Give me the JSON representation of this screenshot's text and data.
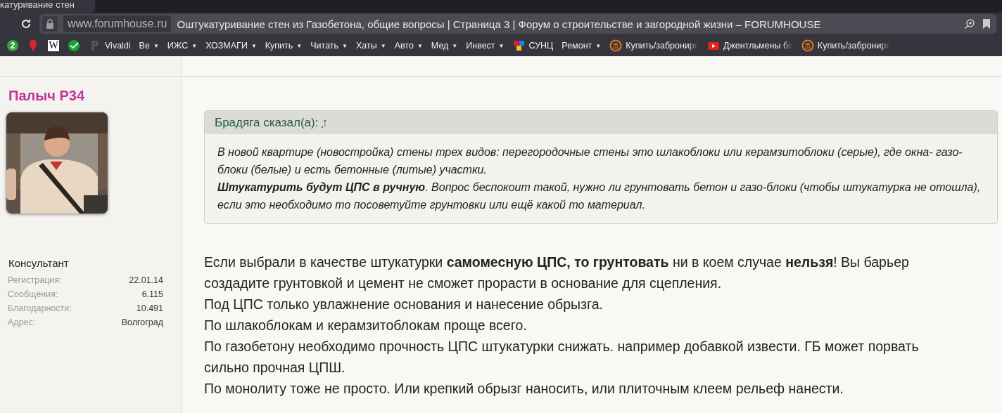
{
  "browser": {
    "tab": {
      "title": "катуривание стен"
    },
    "address_bar": {
      "domain": "www.forumhouse.ru",
      "title": "Оштукатуривание стен из Газобетона, общие вопросы | Страница 3 | Форум о строительстве и загородной жизни – FORUMHOUSE"
    },
    "bookmarks": [
      {
        "kind": "badge",
        "label": "2"
      },
      {
        "kind": "pin"
      },
      {
        "kind": "wiki",
        "label": "W"
      },
      {
        "kind": "leaf"
      },
      {
        "kind": "p-logo",
        "label": "Vivaldi"
      },
      {
        "kind": "folder",
        "label": "Ве",
        "caret": "▼"
      },
      {
        "kind": "folder",
        "label": "ИЖС",
        "caret": "▼"
      },
      {
        "kind": "folder",
        "label": "ХОЗМАГИ",
        "caret": "▼"
      },
      {
        "kind": "folder",
        "label": "Купить",
        "caret": "▼"
      },
      {
        "kind": "folder",
        "label": "Читать",
        "caret": "▼"
      },
      {
        "kind": "folder",
        "label": "Хаты",
        "caret": "▼"
      },
      {
        "kind": "folder",
        "label": "Авто",
        "caret": "▼"
      },
      {
        "kind": "folder",
        "label": "Мед",
        "caret": "▼"
      },
      {
        "kind": "folder",
        "label": "Инвест",
        "caret": "▼"
      },
      {
        "kind": "cubes",
        "label": "СУНЦ"
      },
      {
        "kind": "folder",
        "label": "Ремонт",
        "caret": "▼"
      },
      {
        "kind": "bank",
        "label": "Купить/забронирс"
      },
      {
        "kind": "video",
        "label": "Джентльмены бе"
      },
      {
        "kind": "bank",
        "label": "Купить/забронирс"
      }
    ]
  },
  "author": {
    "name": "Палыч Р34",
    "title": "Консультант",
    "stats": [
      {
        "label": "Регистрация:",
        "value": "22.01.14"
      },
      {
        "label": "Сообщения:",
        "value": "6.115"
      },
      {
        "label": "Благодарности:",
        "value": "10.491"
      },
      {
        "label": "Адрес:",
        "value": "Волгоград"
      }
    ]
  },
  "quote": {
    "author": "Брадяга сказал(а):",
    "link": "↑",
    "paragraphs": [
      "В новой квартире (новостройка) стены трех видов: перегородочные стены это шлакоблоки или керамзитоблоки (серые), где окна- газо-блоки (белые) и есть бетонные (литые) участки.",
      "**Штукатурить будут ЦПС в ручную**. Вопрос беспокоит такой, нужно ли грунтовать бетон и газо-блоки (чтобы штукатурка не отошла), если это необходимо то посоветуйте грунтовки или ещё какой то материал."
    ]
  },
  "message": [
    "Если выбрали в качестве штукатурки **самомесную ЦПС, то грунтовать** ни в коем случае **нельзя**! Вы барьер создадите грунтовкой и цемент не сможет прорасти в основание для сцепления.",
    "Под ЦПС только увлажнение основания и нанесение обрызга.",
    "По шлакоблокам и керамзитоблокам проще всего.",
    "По газобетону необходимо прочность ЦПС штукатурки снижать. например добавкой извести. ГБ может порвать сильно прочная ЦПШ.",
    "По монолиту тоже не просто. Или крепкий обрызг наносить, или плиточным клеем рельеф нанести."
  ]
}
